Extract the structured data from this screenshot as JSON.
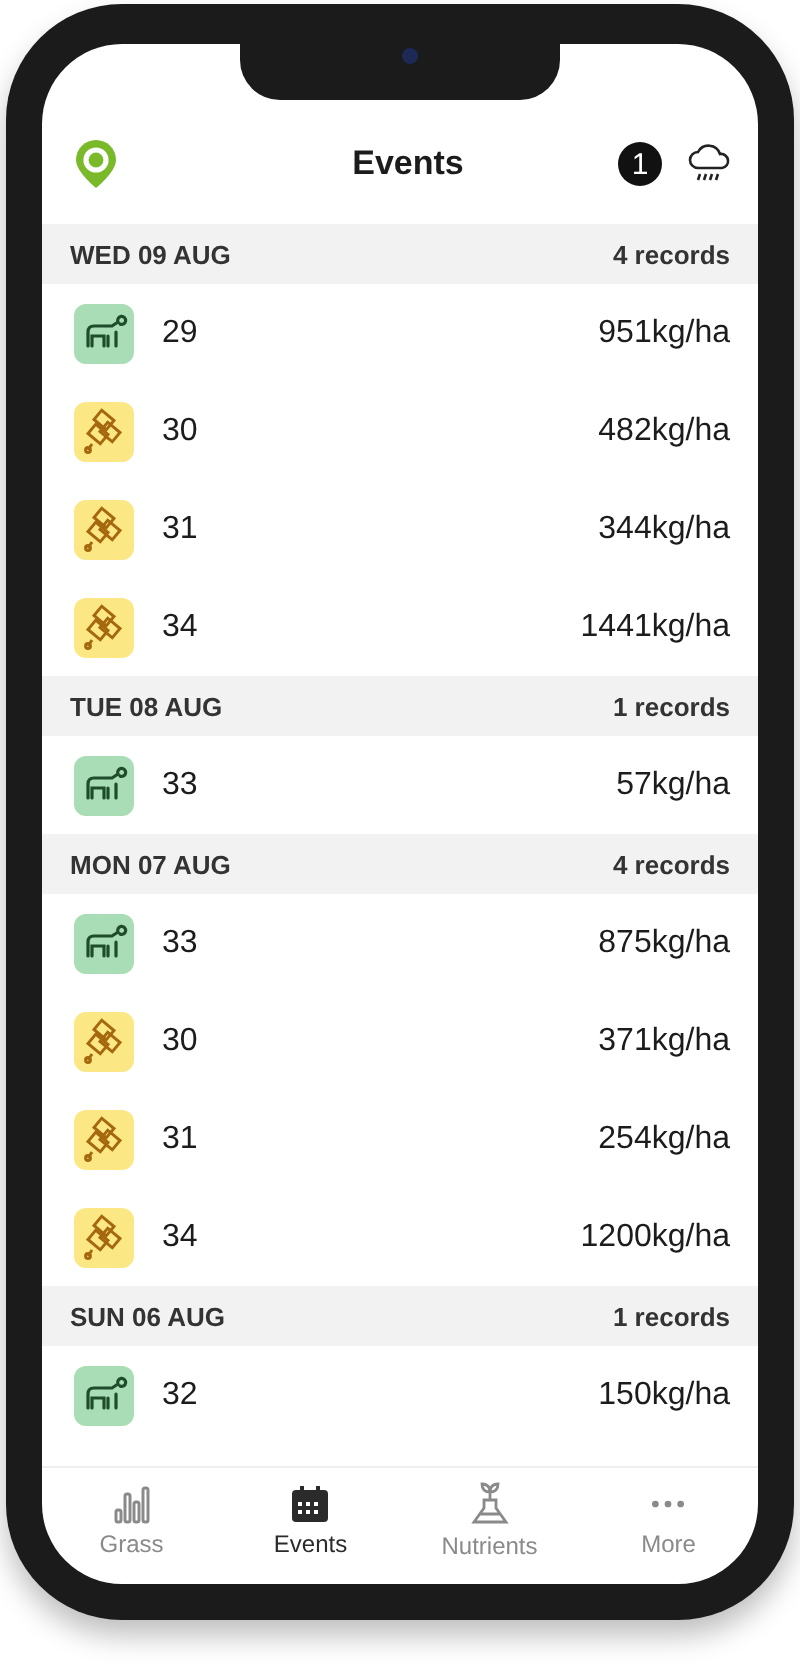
{
  "header": {
    "title": "Events",
    "badge": "1"
  },
  "groups": [
    {
      "date": "WED 09 AUG",
      "count": "4 records",
      "events": [
        {
          "kind": "grazing",
          "paddock": "29",
          "amount": "951kg/ha"
        },
        {
          "kind": "fertiliser",
          "paddock": "30",
          "amount": "482kg/ha"
        },
        {
          "kind": "fertiliser",
          "paddock": "31",
          "amount": "344kg/ha"
        },
        {
          "kind": "fertiliser",
          "paddock": "34",
          "amount": "1441kg/ha"
        }
      ]
    },
    {
      "date": "TUE 08 AUG",
      "count": "1 records",
      "events": [
        {
          "kind": "grazing",
          "paddock": "33",
          "amount": "57kg/ha"
        }
      ]
    },
    {
      "date": "MON 07 AUG",
      "count": "4 records",
      "events": [
        {
          "kind": "grazing",
          "paddock": "33",
          "amount": "875kg/ha"
        },
        {
          "kind": "fertiliser",
          "paddock": "30",
          "amount": "371kg/ha"
        },
        {
          "kind": "fertiliser",
          "paddock": "31",
          "amount": "254kg/ha"
        },
        {
          "kind": "fertiliser",
          "paddock": "34",
          "amount": "1200kg/ha"
        }
      ]
    },
    {
      "date": "SUN 06 AUG",
      "count": "1 records",
      "events": [
        {
          "kind": "grazing",
          "paddock": "32",
          "amount": "150kg/ha"
        }
      ]
    }
  ],
  "tabs": [
    {
      "kind": "chart",
      "label": "Grass",
      "selected": false
    },
    {
      "kind": "calendar",
      "label": "Events",
      "selected": true
    },
    {
      "kind": "flask",
      "label": "Nutrients",
      "selected": false
    },
    {
      "kind": "more",
      "label": "More",
      "selected": false
    }
  ]
}
